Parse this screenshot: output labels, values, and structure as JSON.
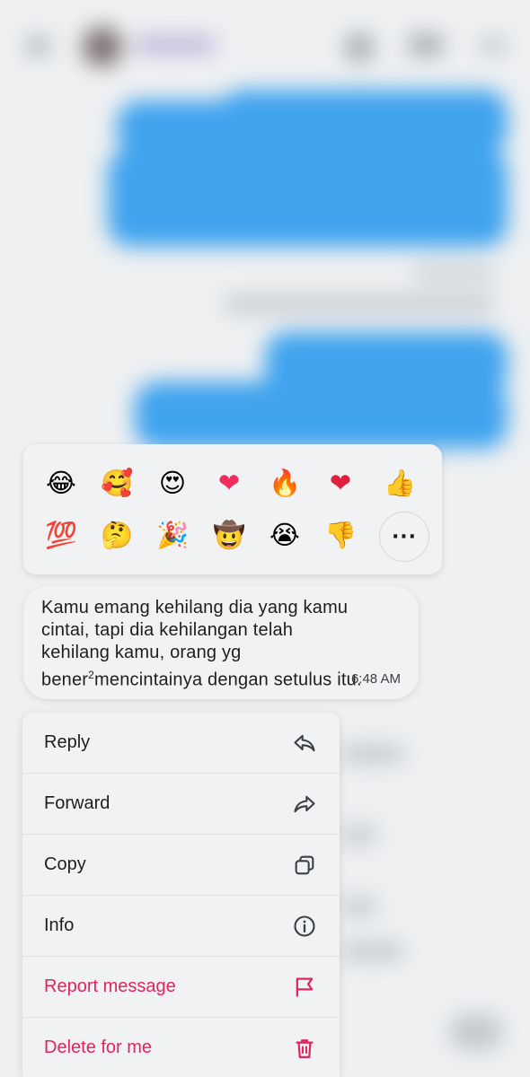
{
  "reactions": {
    "emojis": [
      {
        "name": "face-with-tears-of-joy",
        "glyph": "😂"
      },
      {
        "name": "smiling-face-with-hearts",
        "glyph": "🥰"
      },
      {
        "name": "heart-eyes",
        "glyph": "😍"
      },
      {
        "name": "pink-heart",
        "glyph": "❤"
      },
      {
        "name": "fire",
        "glyph": "🔥"
      },
      {
        "name": "red-heart",
        "glyph": "❤"
      },
      {
        "name": "thumbs-up",
        "glyph": "👍"
      },
      {
        "name": "hundred-points",
        "glyph": "💯"
      },
      {
        "name": "thinking-face",
        "glyph": "🤔"
      },
      {
        "name": "party-popper",
        "glyph": "🎉"
      },
      {
        "name": "cowboy-face",
        "glyph": "🤠"
      },
      {
        "name": "loudly-crying-face",
        "glyph": "😭"
      },
      {
        "name": "thumbs-down",
        "glyph": "👎"
      }
    ],
    "more_label": "···"
  },
  "message": {
    "text_before": "Kamu emang kehilang dia yang kamu cintai, tapi dia kehilangan telah kehilang kamu, orang yg bener",
    "superscript": "2",
    "text_after": "mencintainya dengan setulus itu.",
    "time": "6:48 AM"
  },
  "menu": {
    "items": [
      {
        "label": "Reply",
        "icon": "reply-icon",
        "danger": false
      },
      {
        "label": "Forward",
        "icon": "forward-icon",
        "danger": false
      },
      {
        "label": "Copy",
        "icon": "copy-icon",
        "danger": false
      },
      {
        "label": "Info",
        "icon": "info-icon",
        "danger": false
      },
      {
        "label": "Report message",
        "icon": "flag-icon",
        "danger": true
      },
      {
        "label": "Delete for me",
        "icon": "trash-icon",
        "danger": true
      }
    ]
  },
  "colors": {
    "accent_blue": "#3fa3ee",
    "danger": "#e0245e",
    "surface": "#f1f2f3"
  }
}
